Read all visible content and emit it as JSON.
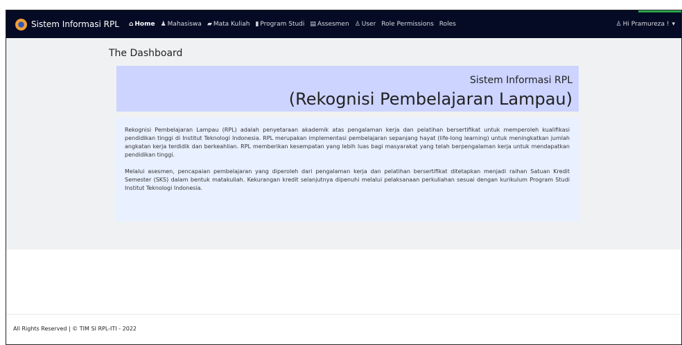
{
  "brand": {
    "title": "Sistem Informasi RPL",
    "icon": "logo-icon"
  },
  "nav": [
    {
      "label": "Home",
      "icon": "home-icon"
    },
    {
      "label": "Mahasiswa",
      "icon": "user-graduate-icon"
    },
    {
      "label": "Mata Kuliah",
      "icon": "book-icon"
    },
    {
      "label": "Program Studi",
      "icon": "bookmark-icon"
    },
    {
      "label": "Assesmen",
      "icon": "list-icon"
    },
    {
      "label": "User",
      "icon": "user-icon"
    },
    {
      "label": "Role Permissions",
      "icon": ""
    },
    {
      "label": "Roles",
      "icon": ""
    }
  ],
  "user": {
    "label": "Hi Pramureza !",
    "icon": "user-icon",
    "caret": "▾"
  },
  "page": {
    "title": "The Dashboard"
  },
  "hero": {
    "subtitle": "Sistem Informasi RPL",
    "title": "(Rekognisi Pembelajaran Lampau)"
  },
  "description": {
    "p1": "Rekognisi Pembelajaran Lampau (RPL) adalah penyetaraan akademik atas pengalaman kerja dan pelatihan bersertifikat untuk memperoleh kualifikasi pendidikan tinggi di Institut Teknologi Indonesia. RPL merupakan implementasi pembelajaran sepanjang hayat (life-long learning) untuk meningkatkan jumlah angkatan kerja terdidik dan berkeahlian. RPL memberikan kesempatan yang lebih luas bagi masyarakat yang telah berpengalaman kerja untuk mendapatkan pendidikan tinggi.",
    "p2": "Melalui asesmen, pencapaian pembelajaran yang diperoleh dari pengalaman kerja dan pelatihan bersertifikat ditetapkan menjadi raihan Satuan Kredit Semester (SKS) dalam bentuk matakuliah. Kekurangan kredit selanjutnya dipenuhi melalui pelaksanaan perkuliahan sesuai dengan kurikulum Program Studi Institut Teknologi Indonesia."
  },
  "footer": {
    "text": "All Rights Reserved | © TIM SI RPL-ITI - 2022"
  },
  "colors": {
    "navbar": "#050b24",
    "hero": "#ccd4ff",
    "desc": "#e9f0ff",
    "page_bg": "#f0f1f2",
    "accent": "#2ea44f"
  }
}
